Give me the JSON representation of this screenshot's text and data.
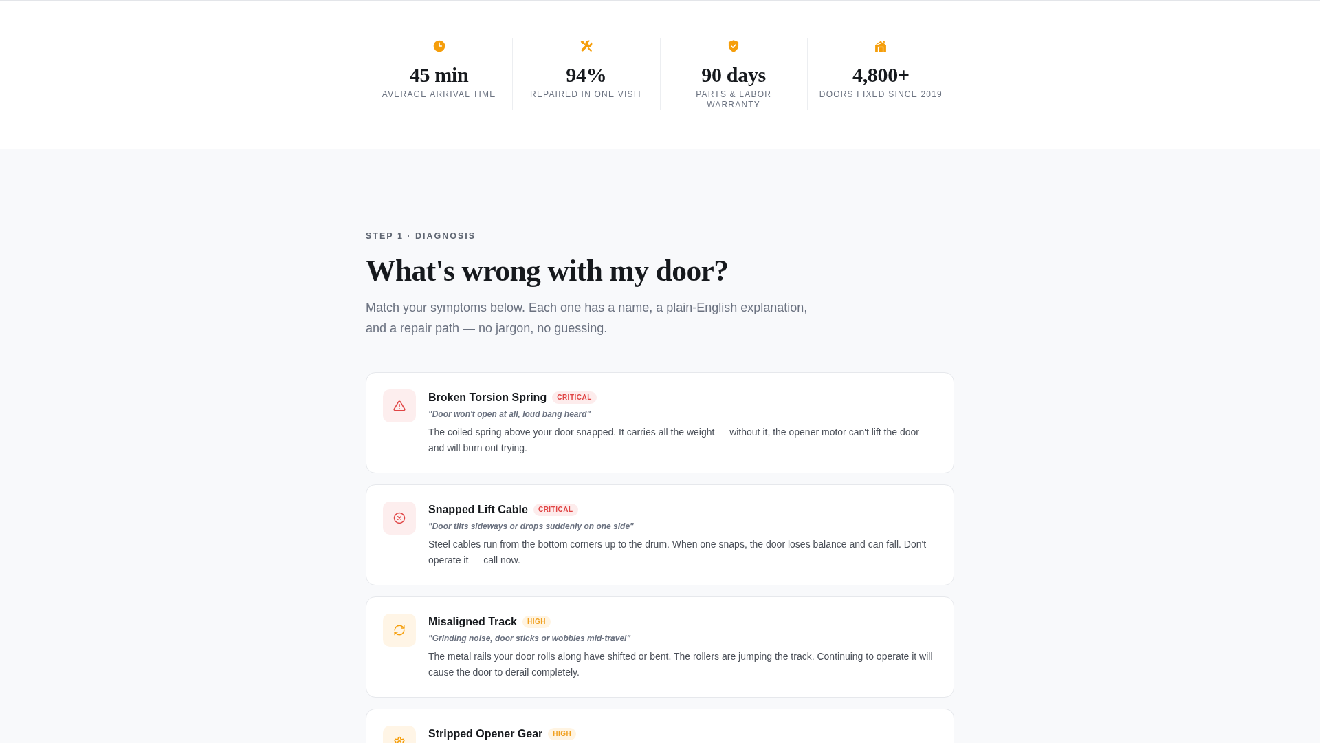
{
  "stats": [
    {
      "value": "45 min",
      "label": "AVERAGE ARRIVAL TIME"
    },
    {
      "value": "94%",
      "label": "REPAIRED IN ONE VISIT"
    },
    {
      "value": "90 days",
      "label": "PARTS & LABOR WARRANTY"
    },
    {
      "value": "4,800+",
      "label": "DOORS FIXED SINCE 2019"
    }
  ],
  "diagnosis": {
    "eyebrow": "STEP 1 · DIAGNOSIS",
    "heading": "What's wrong with my door?",
    "intro": "Match your symptoms below. Each one has a name, a plain-English explanation, and a repair path — no jargon, no guessing.",
    "symptoms": [
      {
        "kind": "critical",
        "name": "Broken Torsion Spring",
        "badge": "CRITICAL",
        "quote": "\"Door won't open at all, loud bang heard\"",
        "description": "The coiled spring above your door snapped. It carries all the weight — without it, the opener motor can't lift the door and will burn out trying."
      },
      {
        "kind": "critical",
        "name": "Snapped Lift Cable",
        "badge": "CRITICAL",
        "quote": "\"Door tilts sideways or drops suddenly on one side\"",
        "description": "Steel cables run from the bottom corners up to the drum. When one snaps, the door loses balance and can fall. Don't operate it — call now."
      },
      {
        "kind": "high",
        "name": "Misaligned Track",
        "badge": "HIGH",
        "quote": "\"Grinding noise, door sticks or wobbles mid-travel\"",
        "description": "The metal rails your door rolls along have shifted or bent. The rollers are jumping the track. Continuing to operate it will cause the door to derail completely."
      },
      {
        "kind": "high",
        "name": "Stripped Opener Gear",
        "badge": "HIGH"
      }
    ]
  }
}
